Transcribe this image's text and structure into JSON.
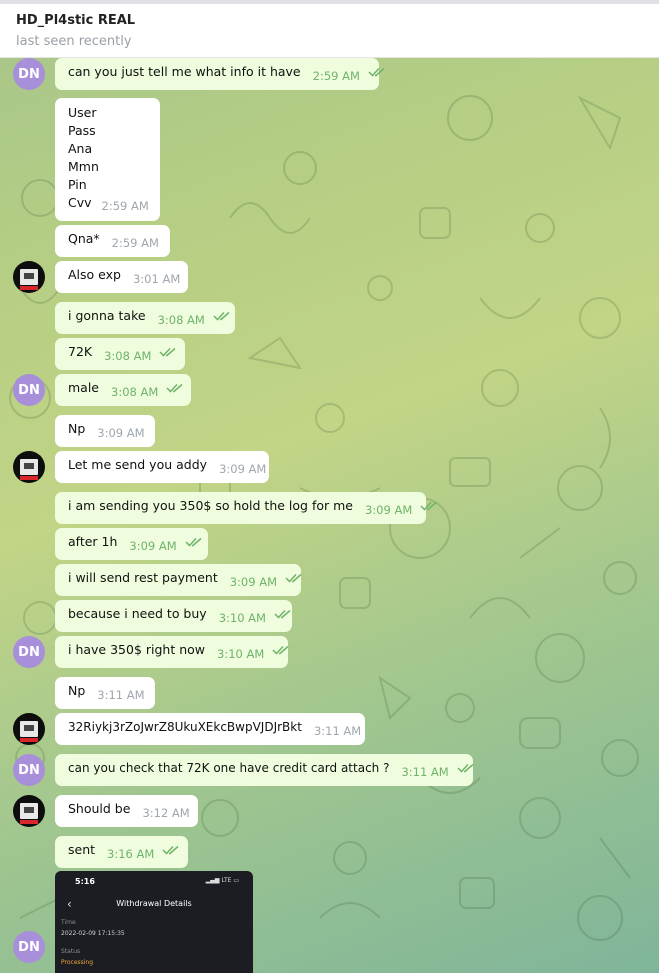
{
  "header": {
    "title": "HD_Pl4stic REAL",
    "status": "last seen recently"
  },
  "colors": {
    "outgoing": "#effdde",
    "incoming": "#ffffff",
    "avatar_dn": "#a88fd9",
    "check": "#6fb36a"
  },
  "avatars": {
    "dn_initials": "DN",
    "contact_icon": "contact-photo-icon"
  },
  "messages": [
    {
      "text": "can you just tell me what info it have",
      "time": "2:59 AM"
    },
    {
      "lines": [
        "User",
        "Pass",
        "Ana",
        "Mmn",
        "Pin",
        "Cvv"
      ],
      "time": "2:59 AM"
    },
    {
      "text": "Qna*",
      "time": "2:59 AM"
    },
    {
      "text": "Also exp",
      "time": "3:01 AM"
    },
    {
      "text": "i gonna take",
      "time": "3:08 AM"
    },
    {
      "text": "72K",
      "time": "3:08 AM"
    },
    {
      "text": "male",
      "time": "3:08 AM"
    },
    {
      "text": "Np",
      "time": "3:09 AM"
    },
    {
      "text": "Let me send you addy",
      "time": "3:09 AM"
    },
    {
      "text": "i am sending you 350$ so hold the log for me",
      "time": "3:09 AM"
    },
    {
      "text": "after 1h",
      "time": "3:09 AM"
    },
    {
      "text": "i will send rest payment",
      "time": "3:09 AM"
    },
    {
      "text": "because i need to buy",
      "time": "3:10 AM"
    },
    {
      "text": "i have 350$ right now",
      "time": "3:10 AM"
    },
    {
      "text": "Np",
      "time": "3:11 AM"
    },
    {
      "text": "32Riykj3rZoJwrZ8UkuXEkcBwpVJDJrBkt",
      "time": "3:11 AM"
    },
    {
      "text": "can you check that 72K one have credit card attach ?",
      "time": "3:11 AM"
    },
    {
      "text": "Should be",
      "time": "3:12 AM"
    },
    {
      "text": "sent",
      "time": "3:16 AM"
    }
  ],
  "screenshot": {
    "clock": "5:16",
    "signal": "LTE",
    "title": "Withdrawal Details",
    "time_label": "Time",
    "time_value": "2022-02-09 17:15:35",
    "status_label": "Status",
    "status_value": "Processing"
  }
}
